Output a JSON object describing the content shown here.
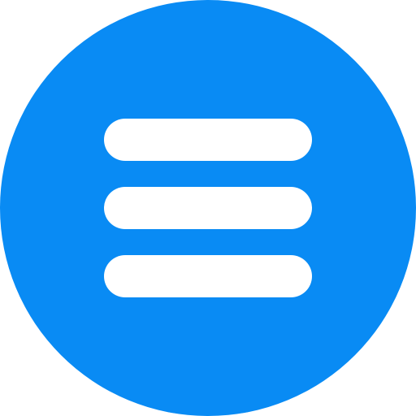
{
  "button": {
    "icon": "hamburger-menu-icon",
    "background_color": "#098bf4",
    "icon_color": "#ffffff"
  }
}
